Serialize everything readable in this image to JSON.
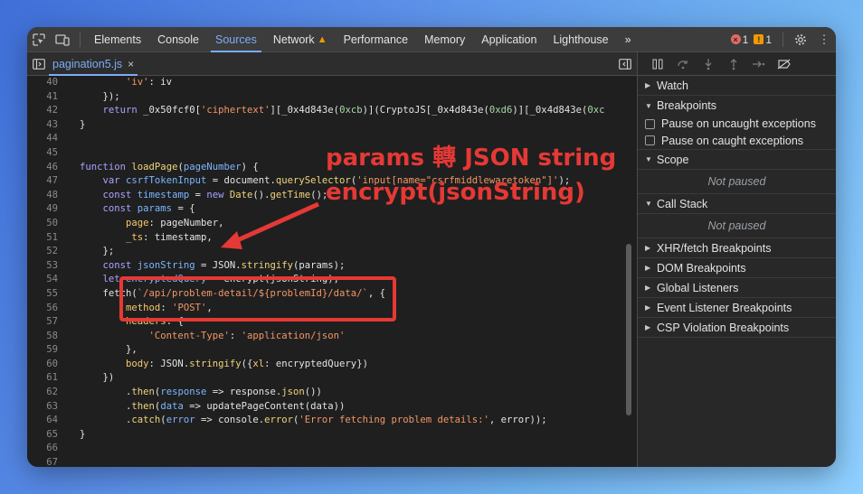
{
  "toolbar": {
    "tabs": [
      "Elements",
      "Console",
      "Sources",
      "Network",
      "Performance",
      "Memory",
      "Application",
      "Lighthouse"
    ],
    "more": "»",
    "error_count": "1",
    "warning_count": "1"
  },
  "file_tab": {
    "name": "pagination5.js",
    "close": "×"
  },
  "code_lines": [
    {
      "n": "40",
      "html": "        <span class='str'>'iv'</span>: iv"
    },
    {
      "n": "41",
      "html": "    });"
    },
    {
      "n": "42",
      "html": "    <span class='kw'>return</span> _0x50fcf0[<span class='str'>'ciphertext'</span>][_0x4d843e(<span class='num'>0xcb</span>)](CryptoJS[_0x4d843e(<span class='num'>0xd6</span>)][_0x4d843e(<span class='num'>0xc</span>"
    },
    {
      "n": "43",
      "html": "}"
    },
    {
      "n": "44",
      "html": ""
    },
    {
      "n": "45",
      "html": ""
    },
    {
      "n": "46",
      "html": "<span class='kw'>function</span> <span class='fn'>loadPage</span>(<span class='var'>pageNumber</span>) {"
    },
    {
      "n": "47",
      "html": "    <span class='kw'>var</span> <span class='var'>csrfTokenInput</span> = document.<span class='fn'>querySelector</span>(<span class='str'>'input[name=\"csrfmiddlewaretoken\"]'</span>);"
    },
    {
      "n": "48",
      "html": "    <span class='kw'>const</span> <span class='var'>timestamp</span> = <span class='kw'>new</span> <span class='fn'>Date</span>().<span class='fn'>getTime</span>();"
    },
    {
      "n": "49",
      "html": "    <span class='kw'>const</span> <span class='var'>params</span> = {"
    },
    {
      "n": "50",
      "html": "        <span class='prop'>page</span>: pageNumber,"
    },
    {
      "n": "51",
      "html": "        <span class='prop'>_ts</span>: timestamp,"
    },
    {
      "n": "52",
      "html": "    };"
    },
    {
      "n": "53",
      "html": "    <span class='kw'>const</span> <span class='var'>jsonString</span> = JSON.<span class='fn'>stringify</span>(params);"
    },
    {
      "n": "54",
      "html": "    <span class='kw'>let</span> <span class='var'>encryptedQuery</span> = encrypt(jsonString);"
    },
    {
      "n": "55",
      "html": "    fetch(<span class='str'>`/api/problem-detail/${problemId}/data/`</span>, {"
    },
    {
      "n": "56",
      "html": "        <span class='prop'>method</span>: <span class='str'>'POST'</span>,"
    },
    {
      "n": "57",
      "html": "        <span class='prop'>headers</span>: {"
    },
    {
      "n": "58",
      "html": "            <span class='str'>'Content-Type'</span>: <span class='str'>'application/json'</span>"
    },
    {
      "n": "59",
      "html": "        },"
    },
    {
      "n": "60",
      "html": "        <span class='prop'>body</span>: JSON.<span class='fn'>stringify</span>({<span class='prop'>xl</span>: encryptedQuery})"
    },
    {
      "n": "61",
      "html": "    })"
    },
    {
      "n": "62",
      "html": "        .<span class='fn'>then</span>(<span class='var'>response</span> =&gt; response.<span class='fn'>json</span>())"
    },
    {
      "n": "63",
      "html": "        .<span class='fn'>then</span>(<span class='var'>data</span> =&gt; updatePageContent(data))"
    },
    {
      "n": "64",
      "html": "        .<span class='fn'>catch</span>(<span class='var'>error</span> =&gt; console.<span class='fn'>error</span>(<span class='str'>'Error fetching problem details:'</span>, error));"
    },
    {
      "n": "65",
      "html": "}"
    },
    {
      "n": "66",
      "html": ""
    },
    {
      "n": "67",
      "html": ""
    }
  ],
  "annotation": {
    "line1": "params 轉 JSON string",
    "line2": "encrypt(jsonString)"
  },
  "right_panel": {
    "watch": "Watch",
    "breakpoints": "Breakpoints",
    "pause_uncaught": "Pause on uncaught exceptions",
    "pause_caught": "Pause on caught exceptions",
    "scope": "Scope",
    "scope_status": "Not paused",
    "call_stack": "Call Stack",
    "call_stack_status": "Not paused",
    "collapsed_sections": [
      "XHR/fetch Breakpoints",
      "DOM Breakpoints",
      "Global Listeners",
      "Event Listener Breakpoints",
      "CSP Violation Breakpoints"
    ]
  },
  "colors": {
    "accent": "#7cacf8",
    "annotation": "#e53935"
  }
}
